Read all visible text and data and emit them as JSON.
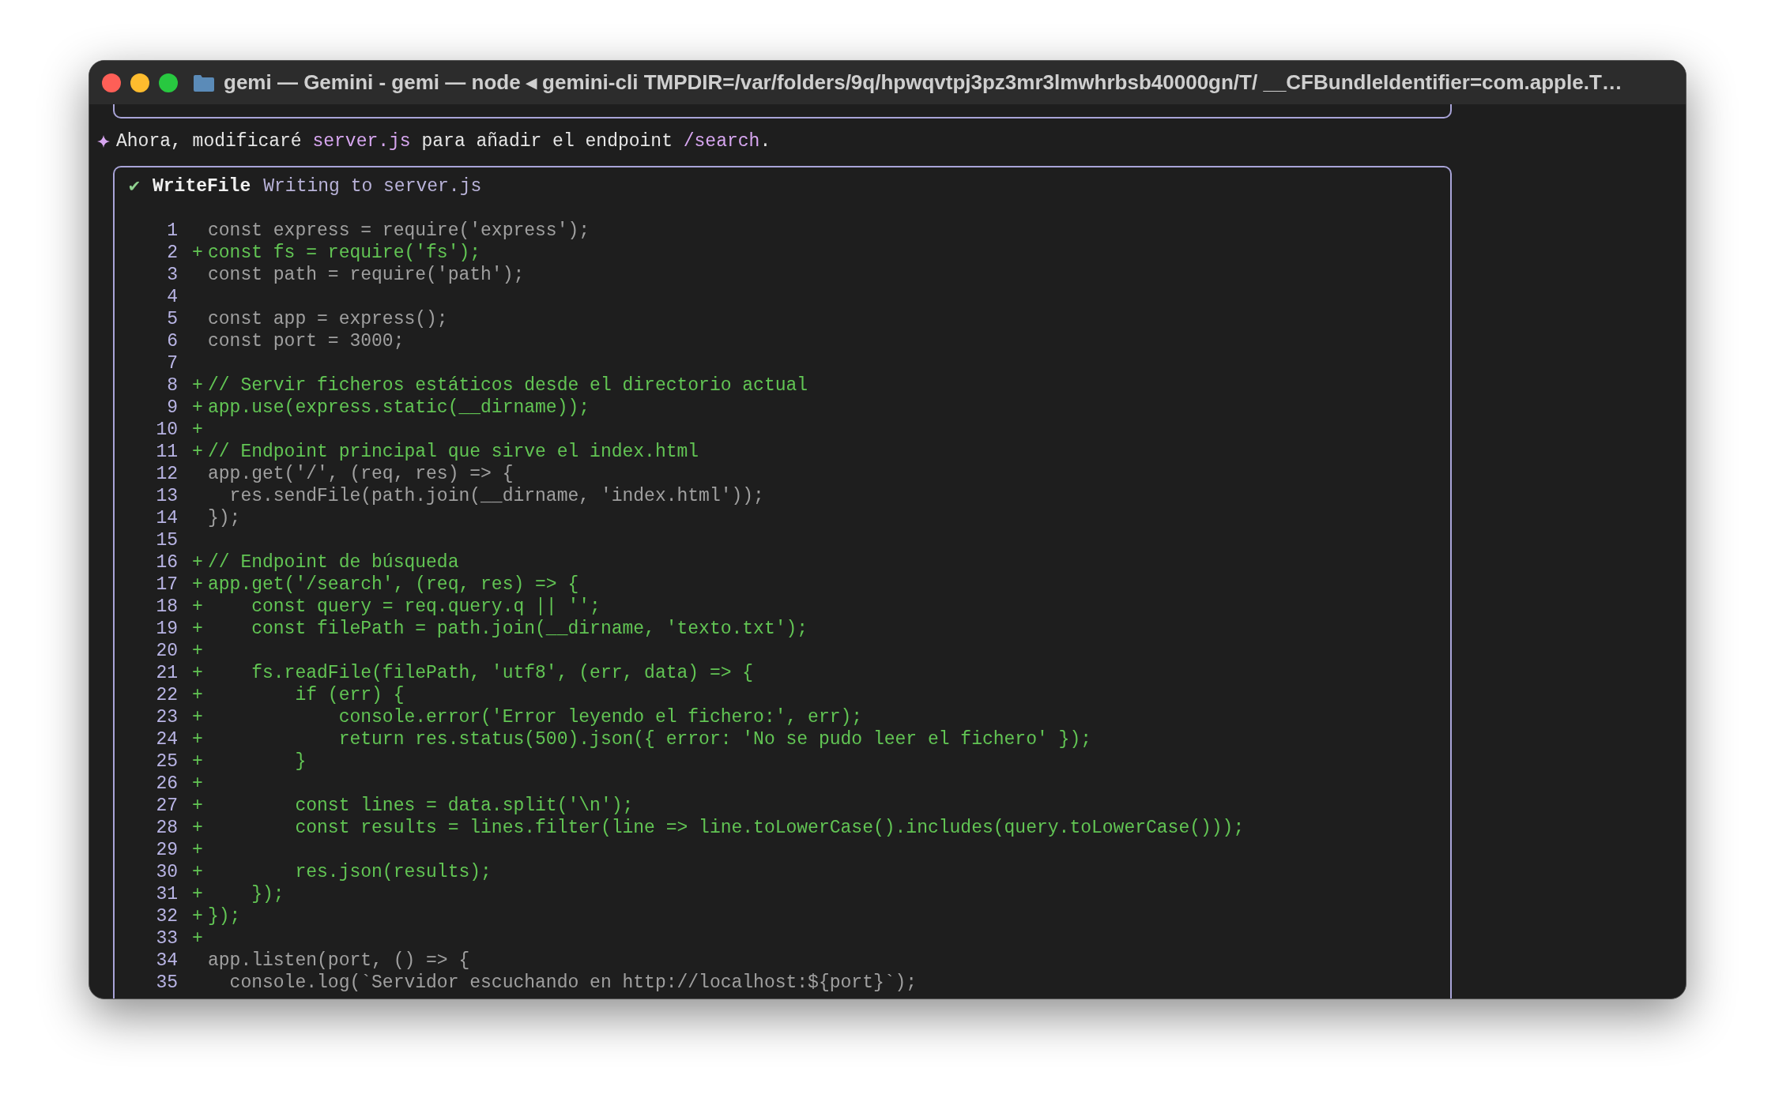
{
  "window": {
    "title": "gemi — Gemini - gemi — node ◂ gemini-cli TMPDIR=/var/folders/9q/hpwqvtpj3pz3mr3lmwhrbsb40000gn/T/ __CFBundleIdentifier=com.apple.T…"
  },
  "message": {
    "segments": [
      {
        "text": "Ahora, modificaré ",
        "kind": "plain"
      },
      {
        "text": "server.js",
        "kind": "code"
      },
      {
        "text": " para añadir el endpoint ",
        "kind": "plain"
      },
      {
        "text": "/search",
        "kind": "code"
      },
      {
        "text": ".",
        "kind": "plain"
      }
    ]
  },
  "tool": {
    "status": "✔",
    "name": "WriteFile",
    "description": "Writing to server.js",
    "lines": [
      {
        "number": "1",
        "added": false,
        "text": "const express = require('express');"
      },
      {
        "number": "2",
        "added": true,
        "marker": "+",
        "text": "const fs = require('fs');"
      },
      {
        "number": "3",
        "added": false,
        "text": "const path = require('path');"
      },
      {
        "number": "4"
      },
      {
        "number": "5",
        "added": false,
        "text": "const app = express();"
      },
      {
        "number": "6",
        "added": false,
        "text": "const port = 3000;"
      },
      {
        "number": "7"
      },
      {
        "number": "8",
        "added": true,
        "marker": "+",
        "text": "// Servir ficheros estáticos desde el directorio actual"
      },
      {
        "number": "9",
        "added": true,
        "marker": "+",
        "text": "app.use(express.static(__dirname));"
      },
      {
        "number": "10",
        "added": true,
        "marker": "+"
      },
      {
        "number": "11",
        "added": true,
        "marker": "+",
        "text": "// Endpoint principal que sirve el index.html"
      },
      {
        "number": "12",
        "added": false,
        "text": "app.get('/', (req, res) => {"
      },
      {
        "number": "13",
        "added": false,
        "text": "  res.sendFile(path.join(__dirname, 'index.html'));"
      },
      {
        "number": "14",
        "added": false,
        "text": "});"
      },
      {
        "number": "15"
      },
      {
        "number": "16",
        "added": true,
        "marker": "+",
        "text": "// Endpoint de búsqueda"
      },
      {
        "number": "17",
        "added": true,
        "marker": "+",
        "text": "app.get('/search', (req, res) => {"
      },
      {
        "number": "18",
        "added": true,
        "marker": "+",
        "text": "    const query = req.query.q || '';"
      },
      {
        "number": "19",
        "added": true,
        "marker": "+",
        "text": "    const filePath = path.join(__dirname, 'texto.txt');"
      },
      {
        "number": "20",
        "added": true,
        "marker": "+"
      },
      {
        "number": "21",
        "added": true,
        "marker": "+",
        "text": "    fs.readFile(filePath, 'utf8', (err, data) => {"
      },
      {
        "number": "22",
        "added": true,
        "marker": "+",
        "text": "        if (err) {"
      },
      {
        "number": "23",
        "added": true,
        "marker": "+",
        "text": "            console.error('Error leyendo el fichero:', err);"
      },
      {
        "number": "24",
        "added": true,
        "marker": "+",
        "text": "            return res.status(500).json({ error: 'No se pudo leer el fichero' });"
      },
      {
        "number": "25",
        "added": true,
        "marker": "+",
        "text": "        }"
      },
      {
        "number": "26",
        "added": true,
        "marker": "+"
      },
      {
        "number": "27",
        "added": true,
        "marker": "+",
        "text": "        const lines = data.split('\\n');"
      },
      {
        "number": "28",
        "added": true,
        "marker": "+",
        "text": "        const results = lines.filter(line => line.toLowerCase().includes(query.toLowerCase()));"
      },
      {
        "number": "29",
        "added": true,
        "marker": "+"
      },
      {
        "number": "30",
        "added": true,
        "marker": "+",
        "text": "        res.json(results);"
      },
      {
        "number": "31",
        "added": true,
        "marker": "+",
        "text": "    });"
      },
      {
        "number": "32",
        "added": true,
        "marker": "+",
        "text": "});"
      },
      {
        "number": "33",
        "added": true,
        "marker": "+"
      },
      {
        "number": "34",
        "added": false,
        "text": "app.listen(port, () => {"
      },
      {
        "number": "35",
        "added": false,
        "text": "  console.log(`Servidor escuchando en http://localhost:${port}`);"
      }
    ]
  }
}
